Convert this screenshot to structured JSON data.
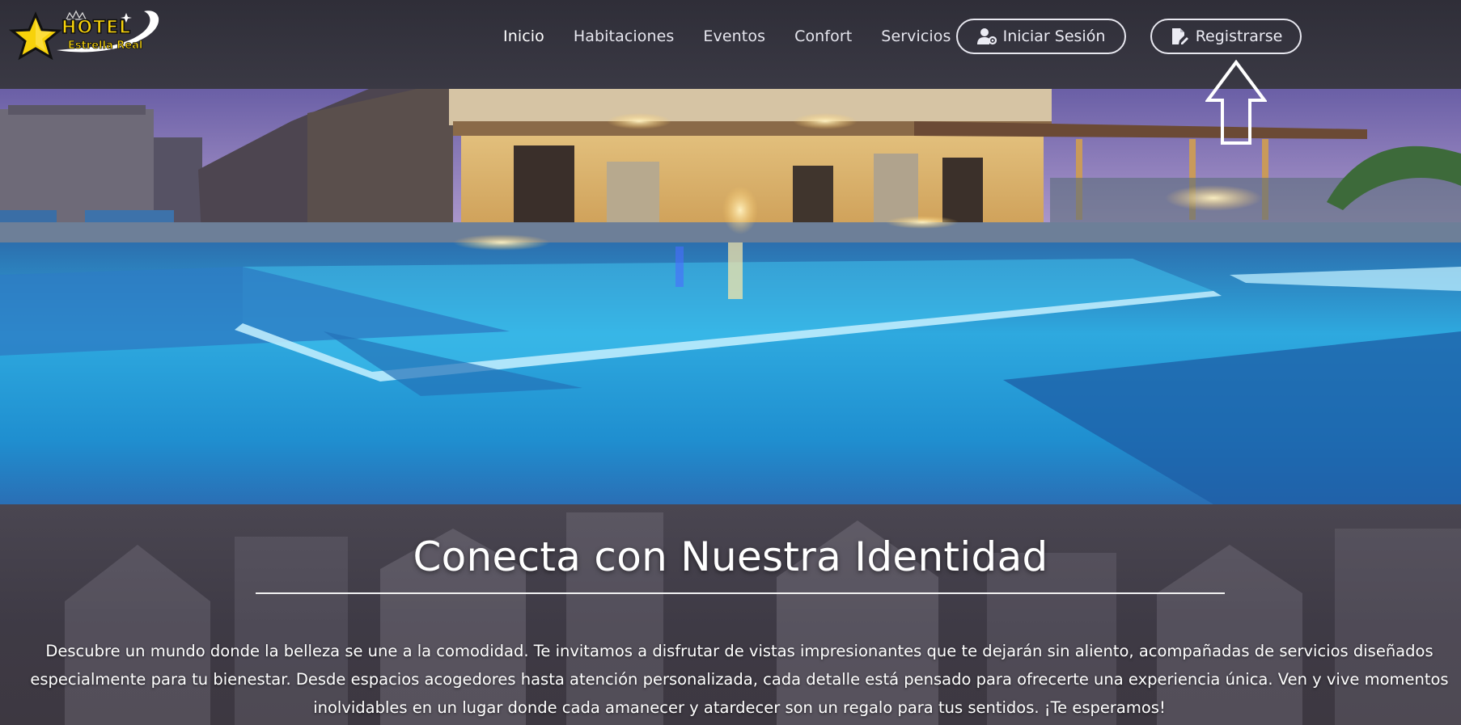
{
  "brand": {
    "logo_line1": "HOTEL",
    "logo_line2": "Estrella Real",
    "icon": "star-logo-icon"
  },
  "nav": {
    "items": [
      {
        "label": "Inicio",
        "active": true
      },
      {
        "label": "Habitaciones",
        "active": false
      },
      {
        "label": "Eventos",
        "active": false
      },
      {
        "label": "Confort",
        "active": false
      },
      {
        "label": "Servicios",
        "active": false
      }
    ],
    "login_label": "Iniciar Sesión",
    "login_icon": "user-gear-icon",
    "register_label": "Registrarse",
    "register_icon": "file-edit-icon"
  },
  "hero": {
    "image": "hotel-pool-night-photo",
    "annotation_icon": "up-arrow-icon"
  },
  "identity": {
    "title": "Conecta con Nuestra Identidad",
    "text": "Descubre un mundo donde la belleza se une a la comodidad. Te invitamos a disfrutar de vistas impresionantes que te dejarán sin aliento, acompañadas de servicios diseñados especialmente para tu bienestar. Desde espacios acogedores hasta atención personalizada, cada detalle está pensado para ofrecerte una experiencia única. Ven y vive momentos inolvidables en un lugar donde cada amanecer y atardecer son un regalo para tus sentidos. ¡Te esperamos!"
  },
  "colors": {
    "header_bg": "#35343e",
    "section_bg": "#3e3a45",
    "pool_blue": "#2ba3da",
    "text": "#ffffff"
  }
}
